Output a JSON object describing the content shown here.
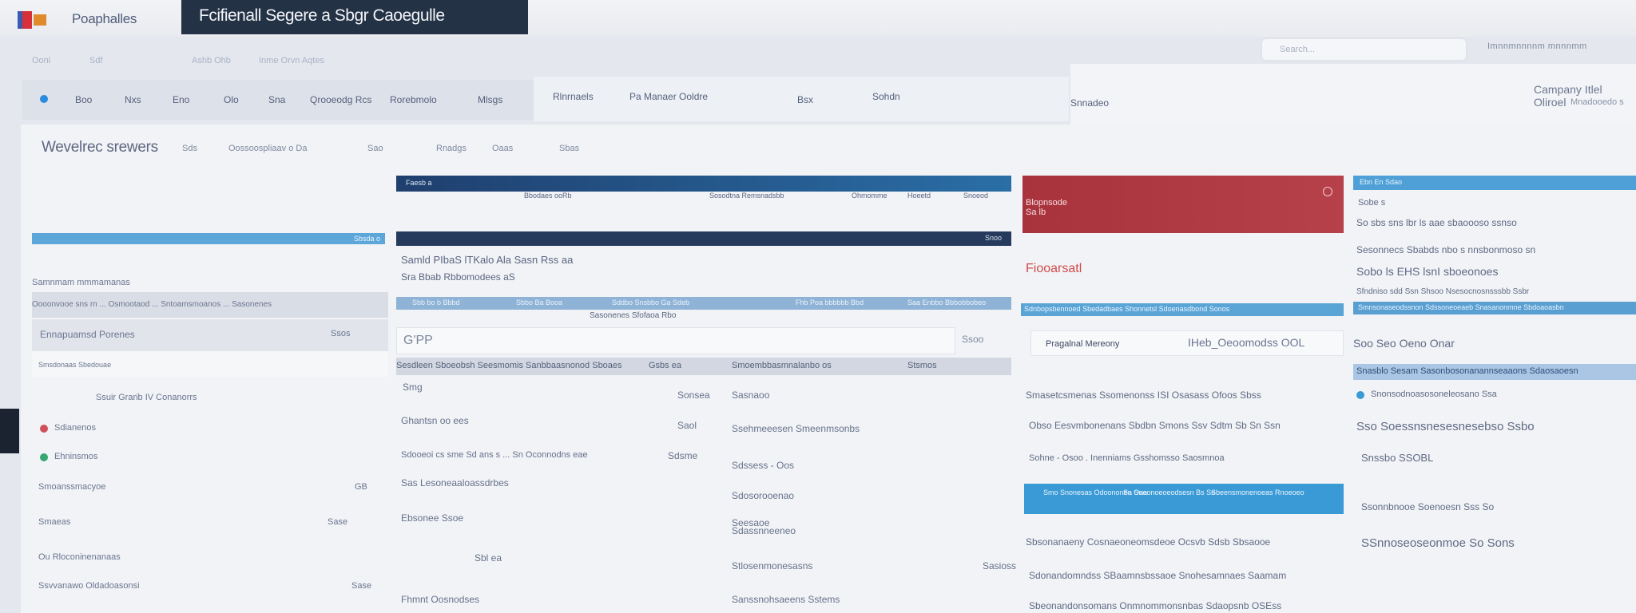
{
  "app": {
    "brand": "Poaphalles",
    "window_title": "Fcifienall Segere a Sbgr Caoegulle"
  },
  "top": {
    "search_placeholder": "Search...",
    "right_text": "Imnnmnnnnm mnnnmm"
  },
  "subnav": [
    "Ooni",
    "Sdf",
    "Ashb Ohb",
    "Inme Orvn Aqtes"
  ],
  "menu": {
    "items": [
      "Boo",
      "Nxs",
      "Eno",
      "Olo",
      "Sna",
      "Qrooeodg Rcs",
      "Rorebmolo",
      "Mlsgs",
      "Rlnrnaels",
      "Pa Manaer Ooldre",
      "Bsx",
      "Sohdn",
      "Snnadeo"
    ],
    "company": "Campany Itlel Oliroel",
    "company_sub": "Mnadooedo s"
  },
  "workspace": {
    "title": "Wevelrec srewers",
    "nav": [
      "Sds",
      "Oossoospliaav o Da",
      "Sao",
      "Rnadgs",
      "Oaas",
      "Sbas"
    ]
  },
  "left_panel": {
    "bar_label": "Sbsda o",
    "rows": [
      "Samnmam mmmamanas",
      "Oooonvooe sns rn ... Osmootaod ... Sntoamsmoanos ... Sasonenes",
      "Ennapuamsd Porenes",
      "Smsdonaas Sbedouae",
      "Ssuir Grarib IV Conanorrs",
      "Sdianenos",
      "Ehninsmos",
      "Smoanssmacyoe",
      "Smaeas",
      "Ou Rloconinenanaas",
      "Ssvvanawo Oldadoasonsi"
    ],
    "values": [
      "Ssos",
      "GB",
      "Sase",
      "Sase"
    ]
  },
  "center": {
    "bar1": [
      "Faesb a",
      "Bbodaes ooRb",
      "Sosodtna Remsnadsbb",
      "Ohmomme",
      "Hoeetd",
      "Snoeod"
    ],
    "bar2": "Snoo",
    "header1": "Samld PIbaS  lTKalo  Ala Sasn Rss aa",
    "header2": "Sra Bbab Rbbomodees aS",
    "strip": [
      "Sbb bo b Bbbd",
      "Sbbo Ba Booa",
      "Sddbo Snsbbo Ga Sdeb",
      "Fhb Poa bbbbbb Bbd",
      "Saa Enbbo Bbbobbobeo"
    ],
    "sub_strip": "Sasonenes Sfofaoa Rbo",
    "input_value": "G'PP",
    "input_right": "Ssoo",
    "gray": [
      "Sesdleen Sboeobsh Seesmomis Sanbbaasnonod Sboaes",
      "Gsbs ea",
      "Smoembbasmnalanbo os",
      "Stsmos"
    ],
    "rows": [
      [
        "Smg",
        "Sonsea",
        "Sasnaoo"
      ],
      [
        "Ghantsn oo ees",
        "Saol",
        "Ssehmeeesen Smeenmsonbs"
      ],
      [
        "Sdooeoi cs sme Sd ans s ... Sn Oconnodns eae",
        "Sdsme",
        "Sdssess - Oos"
      ],
      [
        "Sas Lesoneaaloassdrbes",
        "Sdosorooenao"
      ],
      [
        "Ebsonee Ssoe",
        "Seesaoe"
      ],
      [
        "Sbl ea",
        "Sdassnneeneo"
      ],
      [
        "Stlosenmonesasns",
        "Sasioss"
      ],
      [
        "Fhmnt Oosnodses",
        "Sanssnohsaeens Sstems"
      ]
    ]
  },
  "red_panel": {
    "card_label": "Blopnsode",
    "card_sub": "Sa lb",
    "title": "Fiooarsatl",
    "strip": "Sdnbopsbennoed Sbedadbaes Shonnetsl Sdoenasdbond Sonos",
    "card_text": "Pragalnal Mereony",
    "card_right": "IHeb_Oeoomodss OOL",
    "rows": [
      "Smasetcsmenas Ssomenonss ISI Osasass Ofoos Sbss",
      "Obso Eesvmbonenans Sbdbn Smons Ssv Sdtm Sb Sn Ssn",
      "Sohne - Osoo . Inenniams Gsshomsso Saosmnoa",
      "Sbsonanaeny Cosnaeoneomsdeoe Ocsvb Sdsb Sbsaooe",
      "Sdonandomndss SBaamnsbssaoe Snohesamnaes Saamam",
      "Sbeonandonsomans Onmnommonsnbas Sdaopsnb OSEss"
    ],
    "banner": [
      "Smo Snonesas Odoononen Oaa",
      "Sa Sneonoeoeodsesn Bs Sn",
      "Sbeensmonenoeas Rnoeoeo"
    ]
  },
  "right_panel": {
    "bar": "Ebn En Sdao",
    "label": "Sobe s",
    "strip": "Smnsonaseodssnon Sdssoneoeaeb Snasanonmne Sbdoaoasbn",
    "strip2": "Snasblo Sesam Sasonbosonanannseaaons Sdaosaoesn",
    "rows": [
      "So sbs sns lbr ls aae sbaoooso ssnso",
      "Sesonnecs Sbabds nbo s nnsbonmoso sn",
      "Sobo ls EHS lsnI sboeonoes",
      "Sfndniso sdd Ssn Shsoo Nsesocnosnsssbb Ssbr",
      "Soo Seo Oeno Onar",
      "Snonsodnoasosoneleosano Ssa",
      "Sso Soessnsnesesnesebso Ssbo",
      "Snssbo SSOBL",
      "Ssonnbnooe Soenoesn Sss So",
      "SSnnoseoseonmoe So Sons"
    ]
  },
  "colors": {
    "title_tab": "#243246",
    "accent_blue": "#3a9ad6",
    "accent_red": "#a8333d",
    "navy": "#253a5c"
  }
}
